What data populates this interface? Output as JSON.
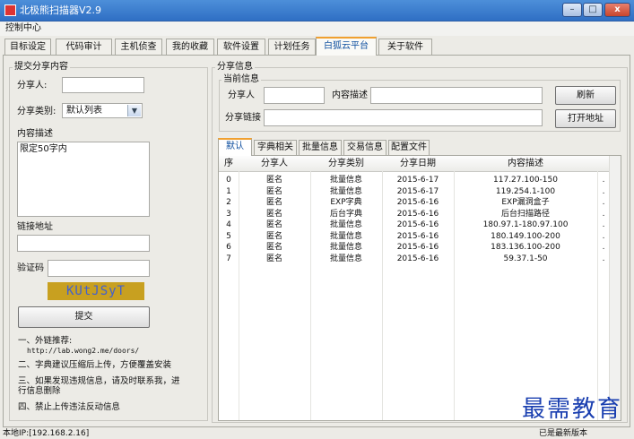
{
  "window": {
    "title": "北极熊扫描器V2.9",
    "min_label": "–",
    "max_label": "□",
    "close_label": "x"
  },
  "menu": {
    "control_center": "控制中心"
  },
  "tabs": [
    "目标设定",
    "代码审计",
    "主机侦查",
    "我的收藏",
    "软件设置",
    "计划任务",
    "白狐云平台",
    "关于软件"
  ],
  "active_tab_index": 6,
  "share_form": {
    "group_title": "提交分享内容",
    "sharer_label": "分享人:",
    "sharer_value": "",
    "category_label": "分享类别:",
    "category_value": "默认列表",
    "content_label": "内容描述",
    "content_value": "限定50字内",
    "link_label": "链接地址",
    "link_value": "",
    "captcha_label": "验证码",
    "captcha_value": "",
    "captcha_text": "KUtJSyT",
    "submit_label": "提交"
  },
  "notes": {
    "n1": "一、外链推荐:",
    "n1_url": "http://lab.wong2.me/doors/",
    "n2": "二、字典建议压缩后上传，方便覆盖安装",
    "n3a": "三、如果发现违规信息，请及时联系我，进",
    "n3b": "行信息删除",
    "n4": "四、禁止上传违法反动信息"
  },
  "share_info": {
    "group_title": "分享信息",
    "current_title": "当前信息",
    "sharer_label": "分享人",
    "sharer_value": "",
    "content_label": "内容描述",
    "content_value": "",
    "link_label": "分享链接",
    "link_value": "",
    "refresh_label": "刷新",
    "open_label": "打开地址"
  },
  "sub_tabs": [
    "默认",
    "字典相关",
    "批量信息",
    "交易信息",
    "配置文件"
  ],
  "table": {
    "headers": [
      "序",
      "分享人",
      "分享类别",
      "分享日期",
      "内容描述"
    ],
    "rows": [
      [
        "0",
        "匿名",
        "批量信息",
        "2015-6-17",
        "117.27.100-150",
        "."
      ],
      [
        "1",
        "匿名",
        "批量信息",
        "2015-6-17",
        "119.254.1-100",
        "."
      ],
      [
        "2",
        "匿名",
        "EXP字典",
        "2015-6-16",
        "EXP漏洞盒子",
        "."
      ],
      [
        "3",
        "匿名",
        "后台字典",
        "2015-6-16",
        "后台扫描路径",
        "."
      ],
      [
        "4",
        "匿名",
        "批量信息",
        "2015-6-16",
        "180.97.1-180.97.100",
        "."
      ],
      [
        "5",
        "匿名",
        "批量信息",
        "2015-6-16",
        "180.149.100-200",
        "."
      ],
      [
        "6",
        "匿名",
        "批量信息",
        "2015-6-16",
        "183.136.100-200",
        "."
      ],
      [
        "7",
        "匿名",
        "批量信息",
        "2015-6-16",
        "59.37.1-50",
        "."
      ]
    ]
  },
  "status": {
    "local_ip": "本地IP:[192.168.2.16]",
    "version": "已是最新版本"
  },
  "watermark": "最需教育",
  "colors": {
    "titlebar": "#2f6fc4",
    "active_tab_border": "#f0a030",
    "captcha_bg": "#c8a020",
    "captcha_fg": "#4060d0"
  }
}
